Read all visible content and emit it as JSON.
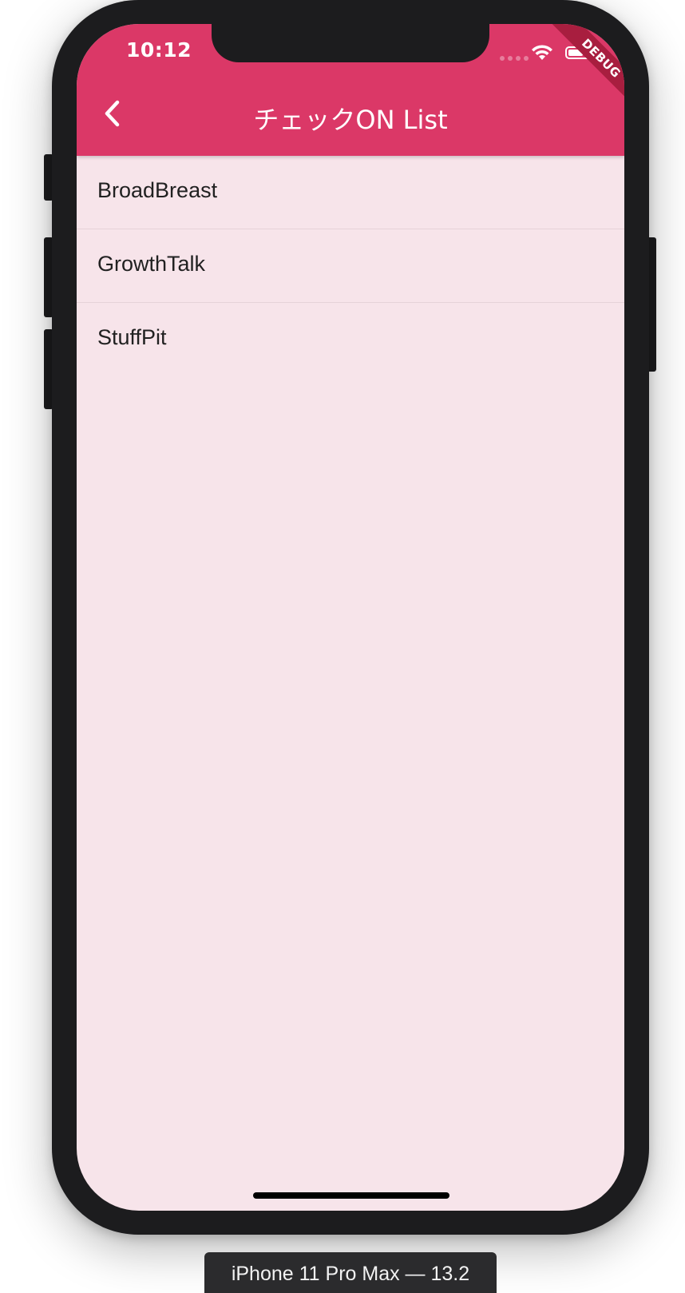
{
  "status_bar": {
    "time": "10:12"
  },
  "debug_banner": "DEBUG",
  "app_bar": {
    "title": "チェックON List",
    "back_icon": "chevron-left-icon",
    "color": "#db3867"
  },
  "list": {
    "items": [
      {
        "label": "BroadBreast"
      },
      {
        "label": "GrowthTalk"
      },
      {
        "label": "StuffPit"
      }
    ]
  },
  "device_label": "iPhone 11 Pro Max — 13.2",
  "colors": {
    "background": "#f7e4ea",
    "app_bar": "#db3867",
    "ribbon": "#a81e3f",
    "device_frame": "#1c1c1e"
  }
}
